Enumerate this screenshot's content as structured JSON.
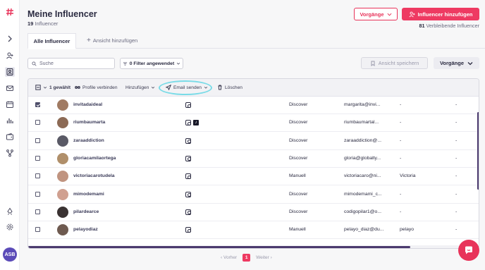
{
  "header": {
    "title": "Meine Influencer",
    "count": "19",
    "count_label": "Influencer",
    "vorgaenge_top": "Vorgänge",
    "add_button": "Influencer hinzufügen",
    "remaining_count": "81",
    "remaining_label": "Verbleibende Influencer"
  },
  "tabs": {
    "active": "Alle Influencer",
    "add_view": "Ansicht hinzufügen"
  },
  "toolbar": {
    "search_placeholder": "Suche",
    "filter_label": "0 Filter angewendet",
    "save_view": "Ansicht speichern",
    "vorgaenge": "Vorgänge"
  },
  "actions": {
    "selected": "1 gewählt",
    "connect": "Profile verbinden",
    "add": "Hinzufügen",
    "email": "Email senden",
    "delete": "Löschen"
  },
  "rows": [
    {
      "name": "invitadaideal",
      "platforms": [
        "instagram"
      ],
      "source": "Discover",
      "email": "margarita@invi...",
      "col5": "-",
      "col6": "-",
      "checked": true,
      "avatar_color": "#a07a62"
    },
    {
      "name": "riumbaumarta",
      "platforms": [
        "instagram",
        "tiktok"
      ],
      "source": "Discover",
      "email": "riumbaumartal...",
      "col5": "-",
      "col6": "-",
      "checked": false,
      "avatar_color": "#8c6a55"
    },
    {
      "name": "zaraaddiction",
      "platforms": [
        "instagram"
      ],
      "source": "Discover",
      "email": "zaraaddiction@...",
      "col5": "-",
      "col6": "-",
      "checked": false,
      "avatar_color": "#5a5a66"
    },
    {
      "name": "gloriacamilaortega",
      "platforms": [
        "instagram"
      ],
      "source": "Discover",
      "email": "gloria@globalty...",
      "col5": "-",
      "col6": "-",
      "checked": false,
      "avatar_color": "#b08f6a"
    },
    {
      "name": "victoriacarotudela",
      "platforms": [
        "instagram"
      ],
      "source": "Manuell",
      "email": "victoriacaro@ni...",
      "col5": "Victoria",
      "col6": "-",
      "checked": false,
      "avatar_color": "#c09480"
    },
    {
      "name": "mimodemami",
      "platforms": [
        "instagram"
      ],
      "source": "Discover",
      "email": "mimodemami_c...",
      "col5": "-",
      "col6": "-",
      "checked": false,
      "avatar_color": "#d0a090"
    },
    {
      "name": "pilardearce",
      "platforms": [
        "instagram"
      ],
      "source": "Discover",
      "email": "codigopilar1@o...",
      "col5": "-",
      "col6": "-",
      "checked": false,
      "avatar_color": "#3a3232"
    },
    {
      "name": "pelayodiaz",
      "platforms": [
        "instagram"
      ],
      "source": "Manuell",
      "email": "pelayo_diaz@du...",
      "col5": "pelayo",
      "col6": "-",
      "checked": false,
      "avatar_color": "#6e5a50"
    }
  ],
  "pagination": {
    "prev": "Vorher",
    "current": "1",
    "next": "Weiter"
  },
  "user": {
    "initials": "ASB"
  },
  "colors": {
    "brand": "#ee3a62",
    "scroll": "#4b3a6e",
    "highlight": "#79dbe7"
  }
}
